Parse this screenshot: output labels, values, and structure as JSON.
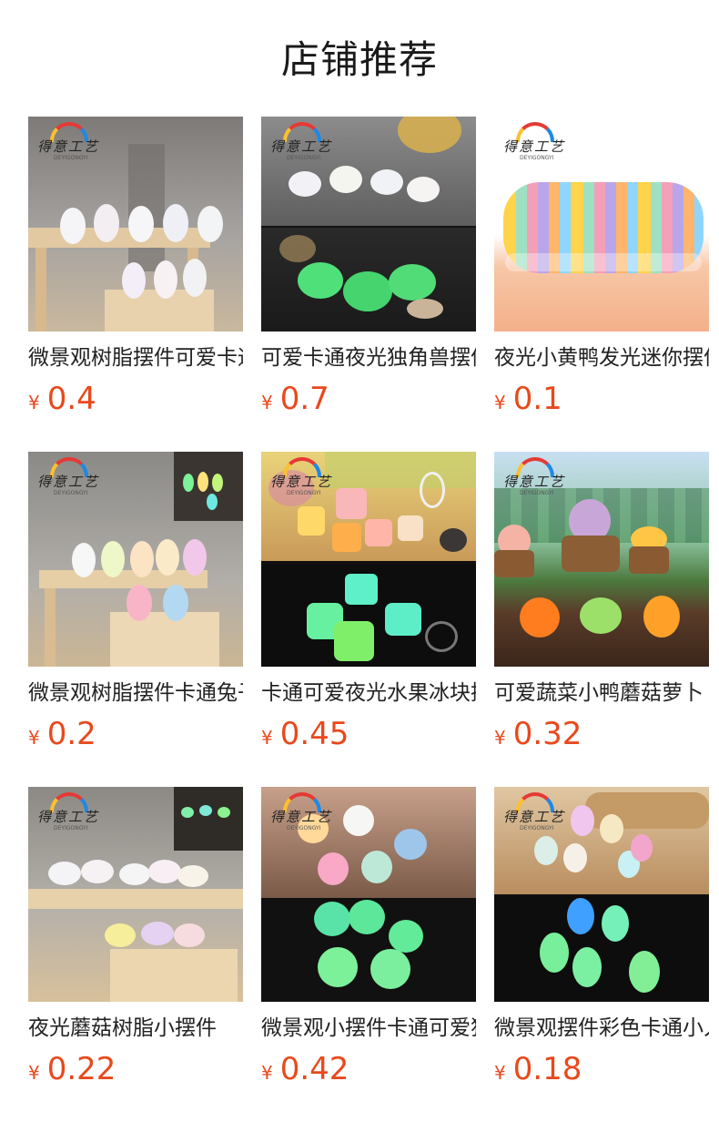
{
  "page": {
    "title": "店铺推荐"
  },
  "logo": {
    "text": "得意工艺",
    "sub": "DEYIGONGYI"
  },
  "currency": "¥",
  "products": [
    {
      "title": "微景观树脂摆件可爱卡通独角兽",
      "price": "0.4"
    },
    {
      "title": "可爱卡通夜光独角兽摆件",
      "price": "0.7"
    },
    {
      "title": "夜光小黄鸭发光迷你摆件",
      "price": "0.1"
    },
    {
      "title": "微景观树脂摆件卡通兔子",
      "price": "0.2"
    },
    {
      "title": "卡通可爱夜光水果冰块摆件",
      "price": "0.45"
    },
    {
      "title": "可爱蔬菜小鸭蘑菇萝卜",
      "price": "0.32"
    },
    {
      "title": "夜光蘑菇树脂小摆件",
      "price": "0.22"
    },
    {
      "title": "微景观小摆件卡通可爱猫咪",
      "price": "0.42"
    },
    {
      "title": "微景观摆件彩色卡通小人",
      "price": "0.18"
    }
  ]
}
